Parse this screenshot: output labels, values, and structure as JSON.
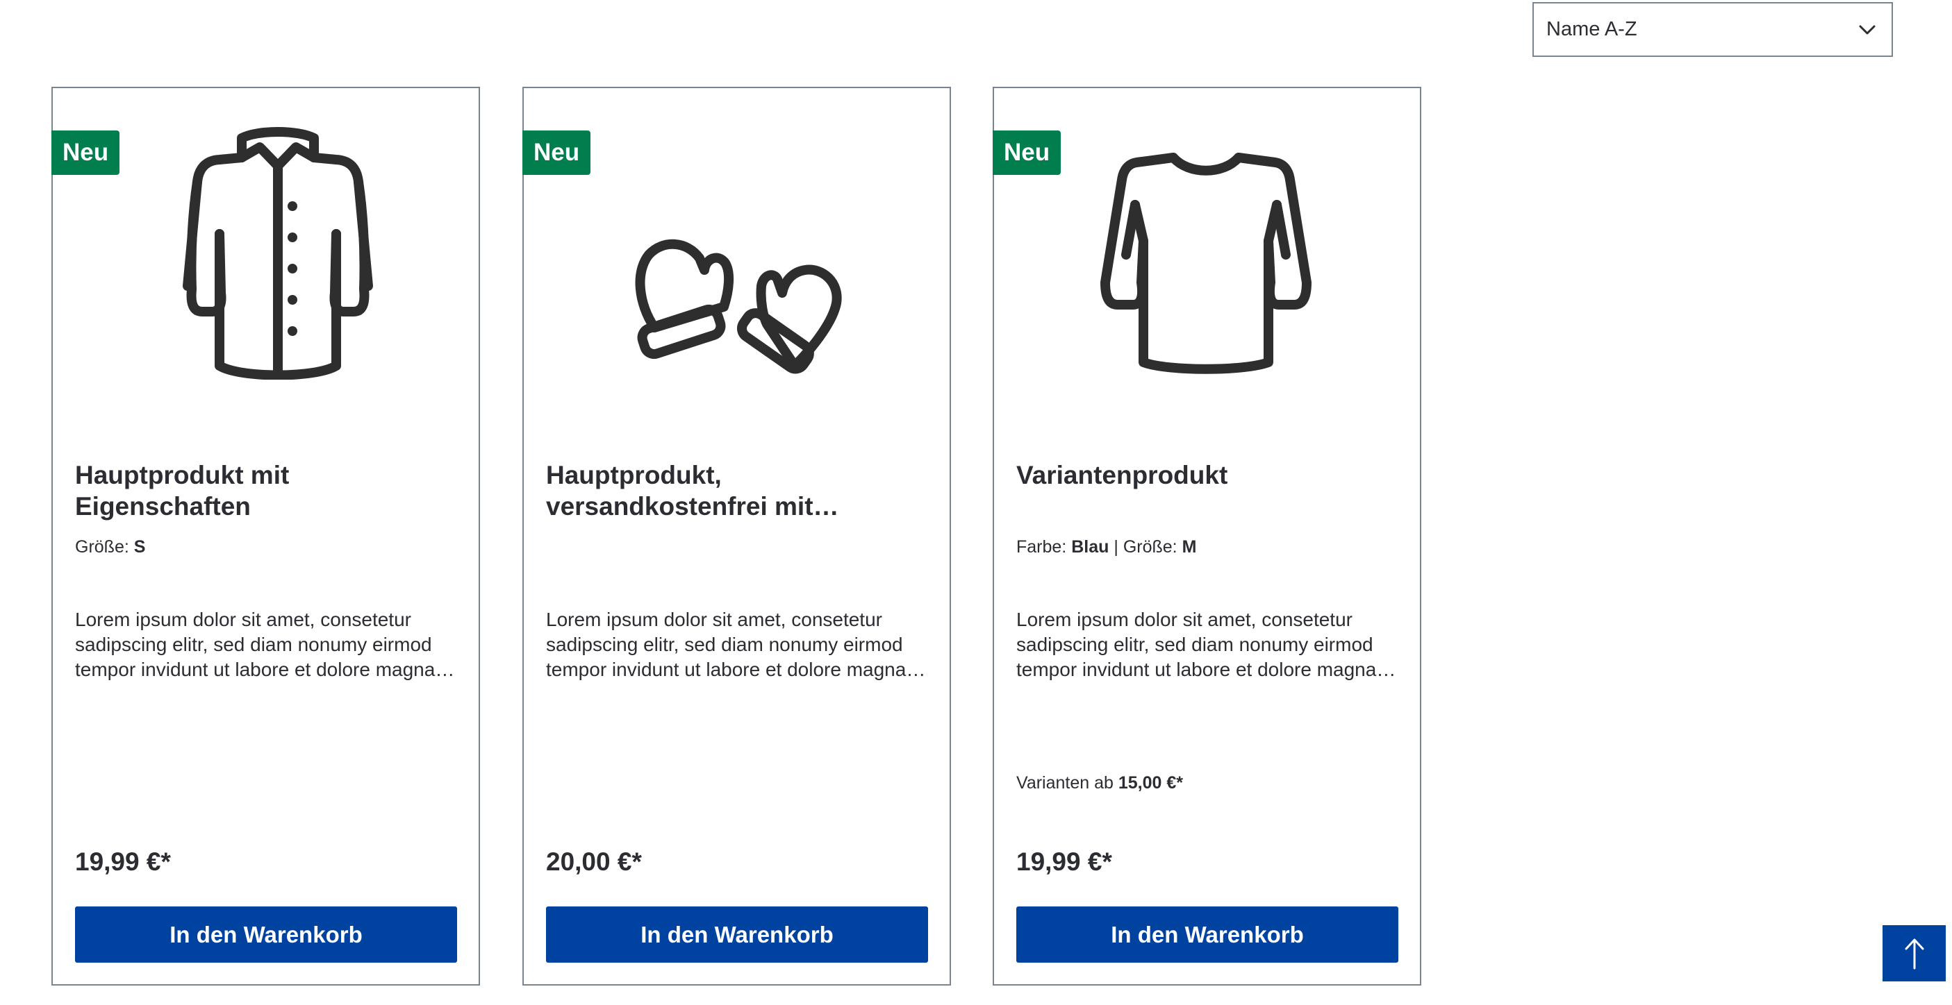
{
  "sorting": {
    "label": "Name A-Z",
    "icon": "chevron-down-icon"
  },
  "products": [
    {
      "badge": "Neu",
      "icon": "jacket-icon",
      "name": "Hauptprodukt mit Eigenschaften",
      "props": [
        {
          "label": "Größe:",
          "value": "S"
        }
      ],
      "description": "Lorem ipsum dolor sit amet, consetetur sadipscing elitr, sed diam nonumy eirmod tempor invidunt ut labore et dolore magna aliquyam erat, sed diam voluptua.",
      "price": "19,99 €*",
      "button": "In den Warenkorb"
    },
    {
      "badge": "Neu",
      "icon": "mittens-icon",
      "name": "Hauptprodukt, versandkostenfrei mit…",
      "props": [],
      "description": "Lorem ipsum dolor sit amet, consetetur sadipscing elitr, sed diam nonumy eirmod tempor invidunt ut labore et dolore magna aliquyam erat, sed diam voluptua.",
      "price": "20,00 €*",
      "button": "In den Warenkorb"
    },
    {
      "badge": "Neu",
      "icon": "sweater-icon",
      "name": "Variantenprodukt",
      "props": [
        {
          "label": "Farbe:",
          "value": "Blau"
        },
        {
          "label": "Größe:",
          "value": "M"
        }
      ],
      "props_separator": "|",
      "description": "Lorem ipsum dolor sit amet, consetetur sadipscing elitr, sed diam nonumy eirmod tempor invidunt ut labore et dolore magna aliquyam erat, sed diam voluptua.",
      "variants_prefix": "Varianten ab",
      "variants_price": "15,00 €*",
      "price": "19,99 €*",
      "button": "In den Warenkorb"
    }
  ],
  "scroll_top": {
    "icon": "arrow-up-icon"
  },
  "colors": {
    "badge": "#007e4e",
    "button": "#0042a0",
    "border": "#798490",
    "text": "#2b2d33"
  }
}
